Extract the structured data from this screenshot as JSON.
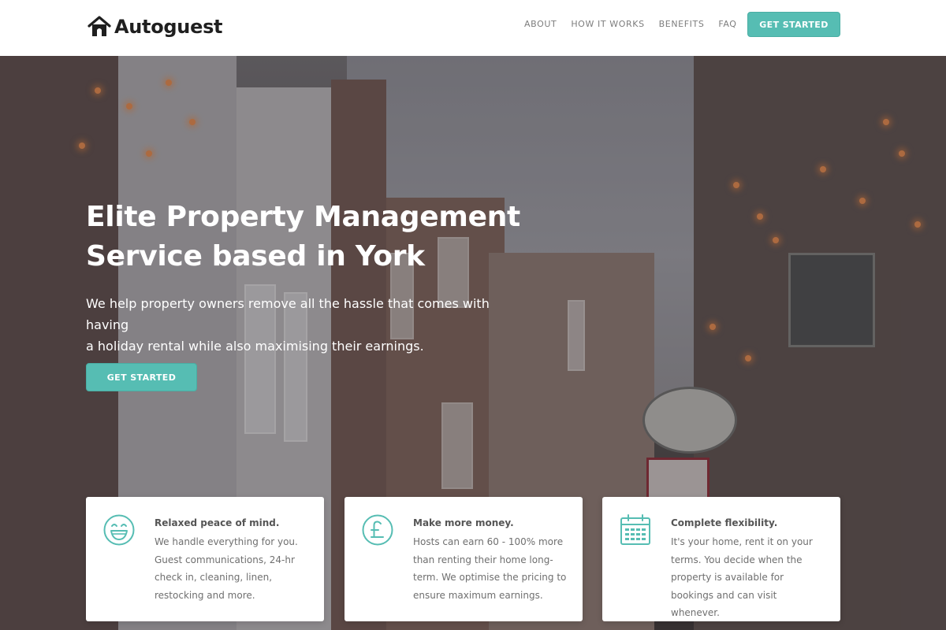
{
  "brand": {
    "name": "Autoguest",
    "icon": "house-icon"
  },
  "nav": {
    "items": [
      {
        "label": "ABOUT"
      },
      {
        "label": "HOW IT WORKS"
      },
      {
        "label": "BENEFITS"
      },
      {
        "label": "FAQ"
      }
    ],
    "cta_label": "GET STARTED"
  },
  "hero": {
    "title_line1": "Elite Property Management",
    "title_line2": "Service based in York",
    "subtitle_line1": "We help property owners remove all the hassle that comes with having",
    "subtitle_line2": "a holiday rental while also maximising their earnings.",
    "cta_label": "GET STARTED"
  },
  "features": [
    {
      "icon": "smiley-face-icon",
      "title": "Relaxed peace of mind.",
      "body": "We handle everything for you. Guest communications, 24-hr check in, cleaning, linen, restocking and more."
    },
    {
      "icon": "pound-coin-icon",
      "title": "Make more money.",
      "body": "Hosts can earn 60 - 100% more than renting their home long-term. We optimise the pricing to ensure maximum earnings."
    },
    {
      "icon": "calendar-icon",
      "title": "Complete flexibility.",
      "body": "It's your home, rent it on your terms. You decide when the property is available for bookings and can visit whenever."
    }
  ],
  "colors": {
    "accent": "#56bdb3",
    "text_dark": "#1f1f1f",
    "nav_text": "#7d7d7d"
  }
}
